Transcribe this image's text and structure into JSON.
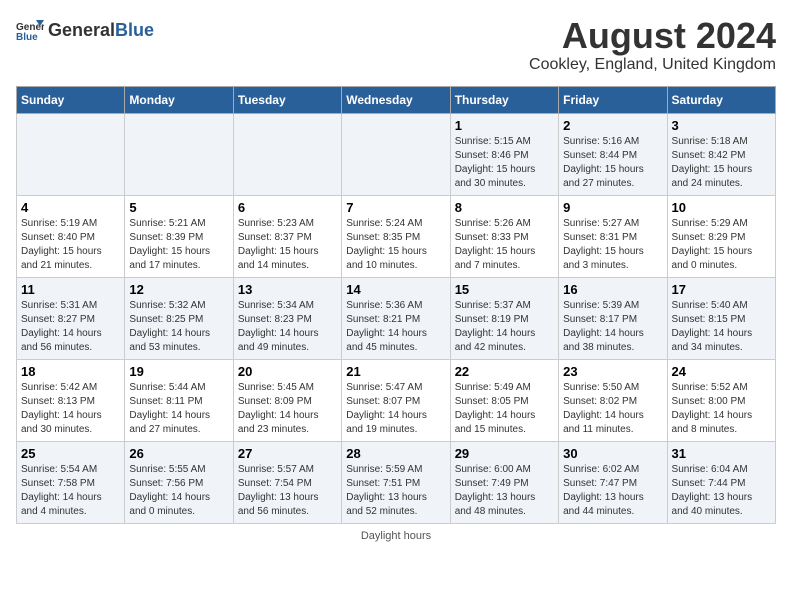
{
  "header": {
    "logo_general": "General",
    "logo_blue": "Blue",
    "title": "August 2024",
    "subtitle": "Cookley, England, United Kingdom"
  },
  "days_of_week": [
    "Sunday",
    "Monday",
    "Tuesday",
    "Wednesday",
    "Thursday",
    "Friday",
    "Saturday"
  ],
  "weeks": [
    [
      {
        "day": "",
        "info": ""
      },
      {
        "day": "",
        "info": ""
      },
      {
        "day": "",
        "info": ""
      },
      {
        "day": "",
        "info": ""
      },
      {
        "day": "1",
        "info": "Sunrise: 5:15 AM\nSunset: 8:46 PM\nDaylight: 15 hours\nand 30 minutes."
      },
      {
        "day": "2",
        "info": "Sunrise: 5:16 AM\nSunset: 8:44 PM\nDaylight: 15 hours\nand 27 minutes."
      },
      {
        "day": "3",
        "info": "Sunrise: 5:18 AM\nSunset: 8:42 PM\nDaylight: 15 hours\nand 24 minutes."
      }
    ],
    [
      {
        "day": "4",
        "info": "Sunrise: 5:19 AM\nSunset: 8:40 PM\nDaylight: 15 hours\nand 21 minutes."
      },
      {
        "day": "5",
        "info": "Sunrise: 5:21 AM\nSunset: 8:39 PM\nDaylight: 15 hours\nand 17 minutes."
      },
      {
        "day": "6",
        "info": "Sunrise: 5:23 AM\nSunset: 8:37 PM\nDaylight: 15 hours\nand 14 minutes."
      },
      {
        "day": "7",
        "info": "Sunrise: 5:24 AM\nSunset: 8:35 PM\nDaylight: 15 hours\nand 10 minutes."
      },
      {
        "day": "8",
        "info": "Sunrise: 5:26 AM\nSunset: 8:33 PM\nDaylight: 15 hours\nand 7 minutes."
      },
      {
        "day": "9",
        "info": "Sunrise: 5:27 AM\nSunset: 8:31 PM\nDaylight: 15 hours\nand 3 minutes."
      },
      {
        "day": "10",
        "info": "Sunrise: 5:29 AM\nSunset: 8:29 PM\nDaylight: 15 hours\nand 0 minutes."
      }
    ],
    [
      {
        "day": "11",
        "info": "Sunrise: 5:31 AM\nSunset: 8:27 PM\nDaylight: 14 hours\nand 56 minutes."
      },
      {
        "day": "12",
        "info": "Sunrise: 5:32 AM\nSunset: 8:25 PM\nDaylight: 14 hours\nand 53 minutes."
      },
      {
        "day": "13",
        "info": "Sunrise: 5:34 AM\nSunset: 8:23 PM\nDaylight: 14 hours\nand 49 minutes."
      },
      {
        "day": "14",
        "info": "Sunrise: 5:36 AM\nSunset: 8:21 PM\nDaylight: 14 hours\nand 45 minutes."
      },
      {
        "day": "15",
        "info": "Sunrise: 5:37 AM\nSunset: 8:19 PM\nDaylight: 14 hours\nand 42 minutes."
      },
      {
        "day": "16",
        "info": "Sunrise: 5:39 AM\nSunset: 8:17 PM\nDaylight: 14 hours\nand 38 minutes."
      },
      {
        "day": "17",
        "info": "Sunrise: 5:40 AM\nSunset: 8:15 PM\nDaylight: 14 hours\nand 34 minutes."
      }
    ],
    [
      {
        "day": "18",
        "info": "Sunrise: 5:42 AM\nSunset: 8:13 PM\nDaylight: 14 hours\nand 30 minutes."
      },
      {
        "day": "19",
        "info": "Sunrise: 5:44 AM\nSunset: 8:11 PM\nDaylight: 14 hours\nand 27 minutes."
      },
      {
        "day": "20",
        "info": "Sunrise: 5:45 AM\nSunset: 8:09 PM\nDaylight: 14 hours\nand 23 minutes."
      },
      {
        "day": "21",
        "info": "Sunrise: 5:47 AM\nSunset: 8:07 PM\nDaylight: 14 hours\nand 19 minutes."
      },
      {
        "day": "22",
        "info": "Sunrise: 5:49 AM\nSunset: 8:05 PM\nDaylight: 14 hours\nand 15 minutes."
      },
      {
        "day": "23",
        "info": "Sunrise: 5:50 AM\nSunset: 8:02 PM\nDaylight: 14 hours\nand 11 minutes."
      },
      {
        "day": "24",
        "info": "Sunrise: 5:52 AM\nSunset: 8:00 PM\nDaylight: 14 hours\nand 8 minutes."
      }
    ],
    [
      {
        "day": "25",
        "info": "Sunrise: 5:54 AM\nSunset: 7:58 PM\nDaylight: 14 hours\nand 4 minutes."
      },
      {
        "day": "26",
        "info": "Sunrise: 5:55 AM\nSunset: 7:56 PM\nDaylight: 14 hours\nand 0 minutes."
      },
      {
        "day": "27",
        "info": "Sunrise: 5:57 AM\nSunset: 7:54 PM\nDaylight: 13 hours\nand 56 minutes."
      },
      {
        "day": "28",
        "info": "Sunrise: 5:59 AM\nSunset: 7:51 PM\nDaylight: 13 hours\nand 52 minutes."
      },
      {
        "day": "29",
        "info": "Sunrise: 6:00 AM\nSunset: 7:49 PM\nDaylight: 13 hours\nand 48 minutes."
      },
      {
        "day": "30",
        "info": "Sunrise: 6:02 AM\nSunset: 7:47 PM\nDaylight: 13 hours\nand 44 minutes."
      },
      {
        "day": "31",
        "info": "Sunrise: 6:04 AM\nSunset: 7:44 PM\nDaylight: 13 hours\nand 40 minutes."
      }
    ]
  ],
  "footer": "Daylight hours"
}
